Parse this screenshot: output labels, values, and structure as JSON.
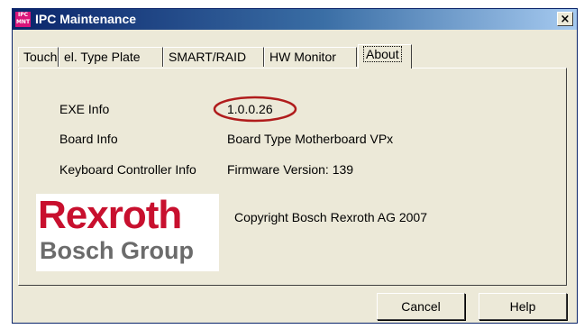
{
  "window": {
    "title": "IPC Maintenance",
    "icon_text": "IPC MNT",
    "close_glyph": "×"
  },
  "tabs": [
    {
      "label": "Touch",
      "active": false
    },
    {
      "label": "el. Type Plate",
      "active": false
    },
    {
      "label": "SMART/RAID",
      "active": false
    },
    {
      "label": "HW Monitor",
      "active": false
    },
    {
      "label": "About",
      "active": true
    }
  ],
  "about": {
    "exe_info_label": "EXE Info",
    "exe_info_value": "1.0.0.26",
    "board_info_label": "Board Info",
    "board_info_value": "Board Type  Motherboard VPx",
    "keyboard_label": "Keyboard Controller Info",
    "keyboard_value": "Firmware Version:  139",
    "copyright": "Copyright Bosch Rexroth AG 2007",
    "logo_brand": "Rexroth",
    "logo_group": "Bosch Group",
    "highlight_color": "#b01c1c"
  },
  "buttons": {
    "cancel": "Cancel",
    "help": "Help"
  },
  "colors": {
    "title_gradient_start": "#0a246a",
    "title_gradient_end": "#a6caf0",
    "face": "#ece9d8",
    "brand_red": "#c8102e"
  }
}
